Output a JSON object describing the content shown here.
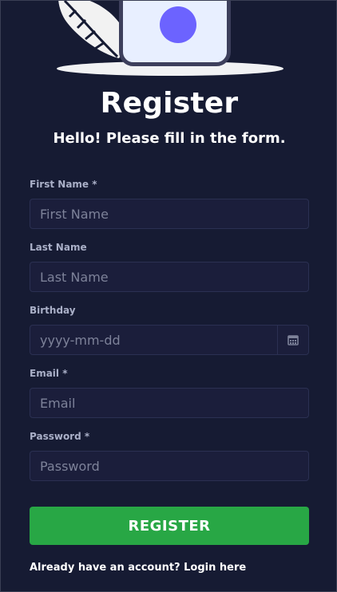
{
  "header": {
    "title": "Register",
    "subtitle": "Hello! Please fill in the form."
  },
  "form": {
    "first_name": {
      "label": "First Name *",
      "placeholder": "First Name",
      "value": ""
    },
    "last_name": {
      "label": "Last Name",
      "placeholder": "Last Name",
      "value": ""
    },
    "birthday": {
      "label": "Birthday",
      "placeholder": "yyyy-mm-dd",
      "value": "",
      "icon": "calendar-icon"
    },
    "email": {
      "label": "Email *",
      "placeholder": "Email",
      "value": ""
    },
    "password": {
      "label": "Password *",
      "placeholder": "Password",
      "value": ""
    },
    "submit_label": "REGISTER"
  },
  "footer": {
    "prompt": "Already have an account? ",
    "login_link": "Login here"
  },
  "colors": {
    "background": "#161b33",
    "input_bg": "#1b1e3b",
    "accent_button": "#28a745",
    "illustration_dot": "#6c63ff"
  }
}
